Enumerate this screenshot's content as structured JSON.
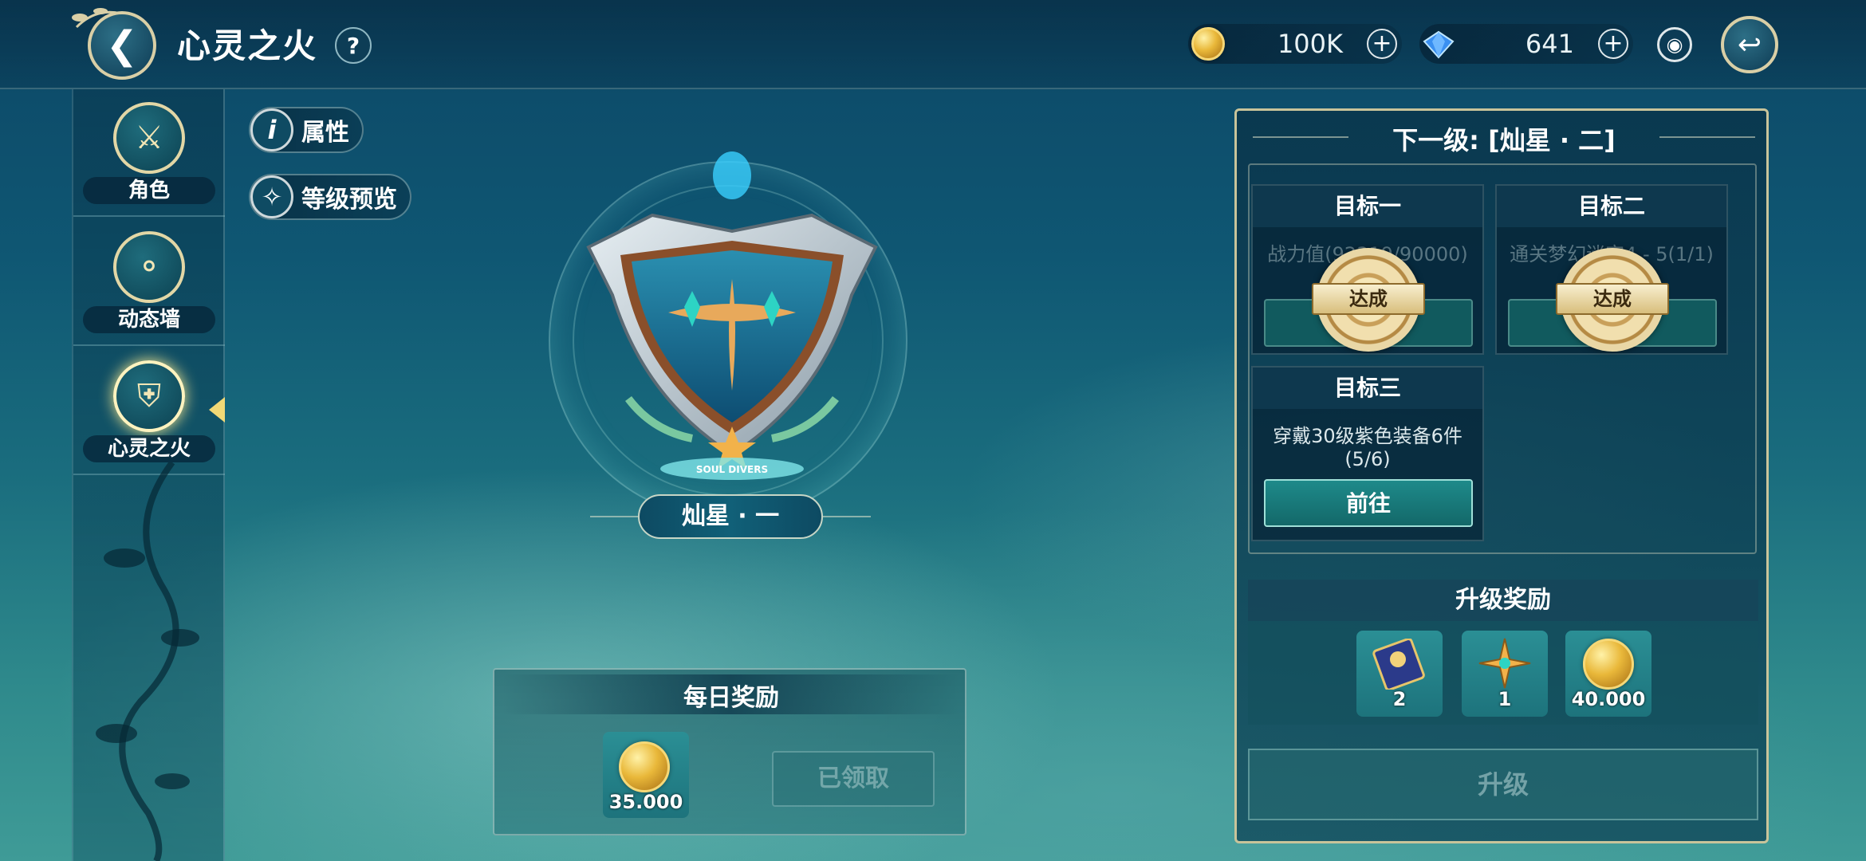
{
  "header": {
    "title": "心灵之火",
    "help_label": "?",
    "gold": "100K",
    "gems": "641",
    "colors": {
      "accent": "#d9cfa6",
      "bar": "#0c3b55"
    }
  },
  "sidebar": {
    "items": [
      {
        "label": "角色",
        "icon": "helmet-icon"
      },
      {
        "label": "动态墙",
        "icon": "chat-bubble-icon"
      },
      {
        "label": "心灵之火",
        "icon": "shield-crest-icon",
        "active": true
      }
    ]
  },
  "actions": {
    "attributes": "属性",
    "level_preview": "等级预览"
  },
  "badge": {
    "emblem_text": "SOUL DIVERS",
    "rank": "灿星 · 一"
  },
  "daily_reward": {
    "title": "每日奖励",
    "amount": "35.000",
    "claimed_label": "已领取"
  },
  "next_level": {
    "title": "下一级: [灿星 · 二]",
    "goals": [
      {
        "title": "目标一",
        "desc": "战力值(92319/90000)",
        "status": "达成"
      },
      {
        "title": "目标二",
        "desc": "通关梦幻迷宫4 - 5(1/1)",
        "status": "达成"
      },
      {
        "title": "目标三",
        "desc": "穿戴30级紫色装备6件(5/6)",
        "button": "前往"
      }
    ],
    "reward_title": "升级奖励",
    "rewards": [
      {
        "icon": "ticket-card-icon",
        "count": "2"
      },
      {
        "icon": "star-compass-icon",
        "count": "1"
      },
      {
        "icon": "gold-coin-icon",
        "count": "40.000"
      }
    ],
    "upgrade_label": "升级"
  }
}
